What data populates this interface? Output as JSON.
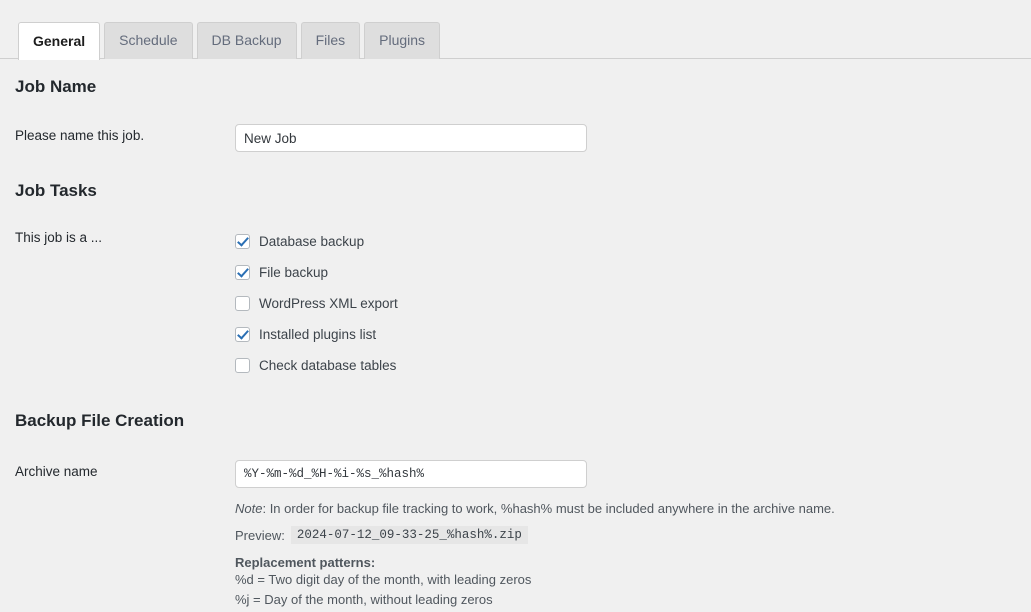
{
  "tabs": [
    {
      "label": "General",
      "active": true
    },
    {
      "label": "Schedule",
      "active": false
    },
    {
      "label": "DB Backup",
      "active": false
    },
    {
      "label": "Files",
      "active": false
    },
    {
      "label": "Plugins",
      "active": false
    }
  ],
  "job_name": {
    "heading": "Job Name",
    "label": "Please name this job.",
    "input_value": "New Job",
    "input_placeholder": "New Job"
  },
  "job_tasks": {
    "heading": "Job Tasks",
    "label": "This job is a ...",
    "items": [
      {
        "label": "Database backup",
        "checked": true
      },
      {
        "label": "File backup",
        "checked": true
      },
      {
        "label": "WordPress XML export",
        "checked": false
      },
      {
        "label": "Installed plugins list",
        "checked": true
      },
      {
        "label": "Check database tables",
        "checked": false
      }
    ]
  },
  "backup_file_creation": {
    "heading": "Backup File Creation",
    "archive_label": "Archive name",
    "archive_value": "%Y-%m-%d_%H-%i-%s_%hash%",
    "archive_placeholder": "%Y-%m-%d_%H-%i-%s_%hash%",
    "note_prefix": "Note",
    "note_text": ": In order for backup file tracking to work, %hash% must be included anywhere in the archive name.",
    "preview_label": "Preview:",
    "preview_value": "2024-07-12_09-33-25_%hash%.zip",
    "patterns_title": "Replacement patterns:",
    "patterns": [
      "%d = Two digit day of the month, with leading zeros",
      "%j = Day of the month, without leading zeros"
    ]
  },
  "colors": {
    "page_bg": "#f0f0f0",
    "tab_active_bg": "#ffffff",
    "tab_inactive_bg": "#dedede",
    "border": "#cfcfcf",
    "check_accent": "#2a6fb4",
    "text": "#23282d",
    "muted_text": "#50575e"
  }
}
